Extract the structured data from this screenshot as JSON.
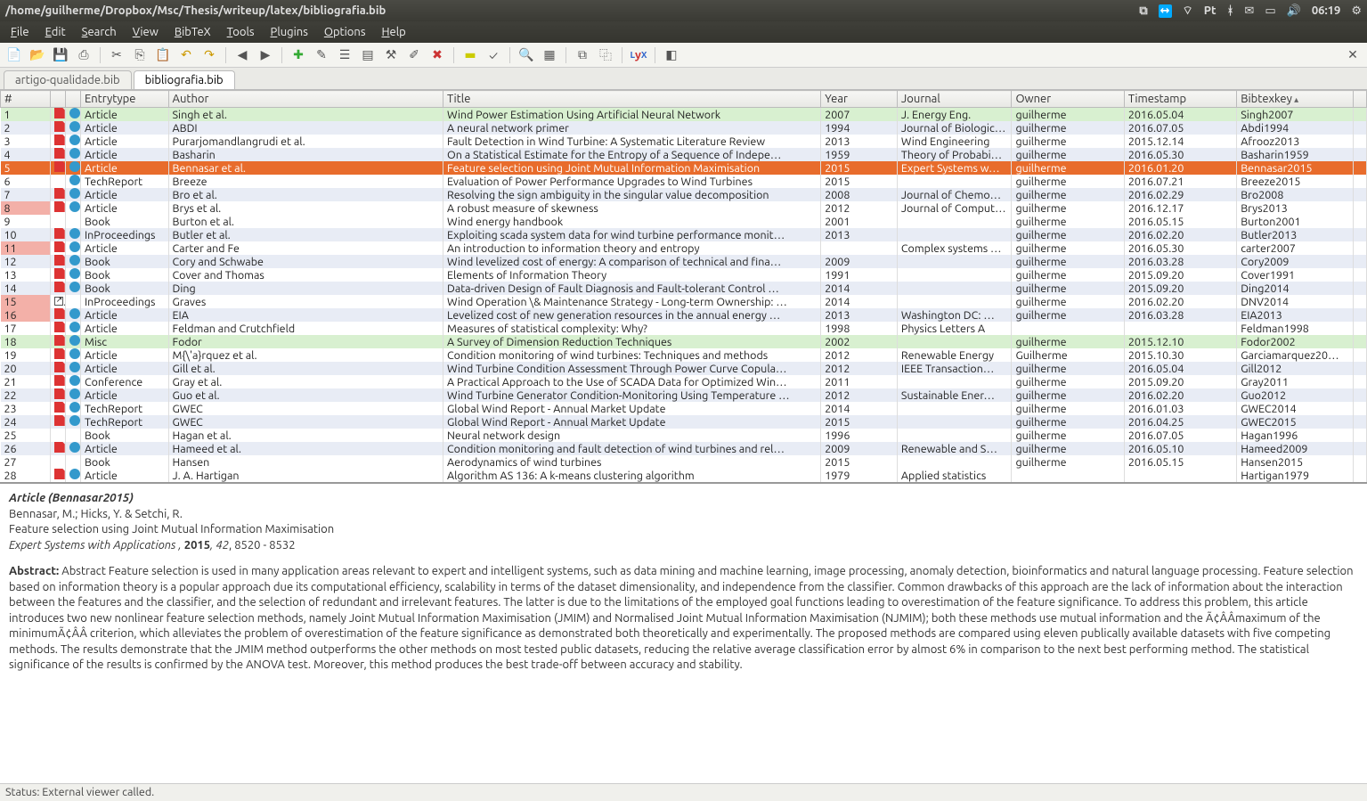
{
  "window": {
    "title": "/home/guilherme/Dropbox/Msc/Thesis/writeup/latex/bibliografia.bib"
  },
  "sys": {
    "clock": "06:19",
    "kb": "Pt"
  },
  "menu": {
    "file": "File",
    "edit": "Edit",
    "search": "Search",
    "view": "View",
    "bibtex": "BibTeX",
    "tools": "Tools",
    "plugins": "Plugins",
    "options": "Options",
    "help": "Help"
  },
  "tabs": [
    {
      "label": "artigo-qualidade.bib",
      "active": false
    },
    {
      "label": "bibliografia.bib",
      "active": true
    }
  ],
  "columns": {
    "num": "#",
    "type": "Entrytype",
    "auth": "Author",
    "title": "Title",
    "year": "Year",
    "jrnl": "Journal",
    "own": "Owner",
    "ts": "Timestamp",
    "key": "Bibtexkey"
  },
  "rows": [
    {
      "n": "1",
      "pdf": true,
      "lnk": true,
      "type": "Article",
      "auth": "Singh et al.",
      "title": "Wind Power Estimation Using Artificial Neural Network",
      "year": "2007",
      "jrnl": "J. Energy Eng.",
      "own": "guilherme",
      "ts": "2016.05.04",
      "key": "Singh2007",
      "cls": "green"
    },
    {
      "n": "2",
      "pdf": true,
      "lnk": true,
      "type": "Article",
      "auth": "ABDI",
      "title": "A neural network primer",
      "year": "1994",
      "jrnl": "Journal of Biologic…",
      "own": "guilherme",
      "ts": "2016.07.05",
      "key": "Abdi1994",
      "cls": "even"
    },
    {
      "n": "3",
      "pdf": true,
      "lnk": true,
      "type": "Article",
      "auth": "Purarjomandlangrudi et al.",
      "title": "Fault Detection in Wind Turbine: A Systematic Literature Review",
      "year": "2013",
      "jrnl": "Wind Engineering",
      "own": "guilherme",
      "ts": "2015.12.14",
      "key": "Afrooz2013",
      "cls": "odd"
    },
    {
      "n": "4",
      "pdf": true,
      "lnk": true,
      "type": "Article",
      "auth": "Basharin",
      "title": "On a Statistical Estimate for the Entropy of a Sequence of Indepe…",
      "year": "1959",
      "jrnl": "Theory of Probabi…",
      "own": "guilherme",
      "ts": "2016.05.30",
      "key": "Basharin1959",
      "cls": "even"
    },
    {
      "n": "5",
      "pdf": true,
      "lnk": true,
      "type": "Article",
      "auth": "Bennasar et al.",
      "title": "Feature selection using Joint Mutual Information Maximisation",
      "year": "2015",
      "jrnl": "Expert Systems w…",
      "own": "guilherme",
      "ts": "2016.01.20",
      "key": "Bennasar2015",
      "cls": "sel"
    },
    {
      "n": "6",
      "pdf": false,
      "lnk": true,
      "type": "TechReport",
      "auth": "Breeze",
      "title": "Evaluation of Power Performance Upgrades to Wind Turbines",
      "year": "2015",
      "jrnl": "",
      "own": "guilherme",
      "ts": "2016.07.21",
      "key": "Breeze2015",
      "cls": "odd"
    },
    {
      "n": "7",
      "pdf": true,
      "lnk": true,
      "type": "Article",
      "auth": "Bro et al.",
      "title": "Resolving the sign ambiguity in the singular value decomposition",
      "year": "2008",
      "jrnl": "Journal of Chemo…",
      "own": "guilherme",
      "ts": "2016.02.29",
      "key": "Bro2008",
      "cls": "even"
    },
    {
      "n": "8",
      "pdf": true,
      "lnk": true,
      "type": "Article",
      "auth": "Brys et al.",
      "title": "A robust measure of skewness",
      "year": "2012",
      "jrnl": "Journal of Comput…",
      "own": "guilherme",
      "ts": "2016.12.17",
      "key": "Brys2013",
      "cls": "odd red"
    },
    {
      "n": "9",
      "pdf": false,
      "lnk": false,
      "type": "Book",
      "auth": "Burton et al.",
      "title": "Wind energy handbook",
      "year": "2001",
      "jrnl": "",
      "own": "guilherme",
      "ts": "2016.05.15",
      "key": "Burton2001",
      "cls": "odd"
    },
    {
      "n": "10",
      "pdf": true,
      "lnk": true,
      "type": "InProceedings",
      "auth": "Butler et al.",
      "title": "Exploiting scada system data for wind turbine performance monit…",
      "year": "2013",
      "jrnl": "",
      "own": "guilherme",
      "ts": "2016.02.20",
      "key": "Butler2013",
      "cls": "even"
    },
    {
      "n": "11",
      "pdf": true,
      "lnk": true,
      "type": "Article",
      "auth": "Carter and Fe",
      "title": "An introduction to information theory and entropy",
      "year": "",
      "jrnl": "Complex systems …",
      "own": "guilherme",
      "ts": "2016.05.30",
      "key": "carter2007",
      "cls": "odd red"
    },
    {
      "n": "12",
      "pdf": true,
      "lnk": true,
      "type": "Book",
      "auth": "Cory and Schwabe",
      "title": "Wind levelized cost of energy: A comparison of technical and fina…",
      "year": "2009",
      "jrnl": "",
      "own": "guilherme",
      "ts": "2016.03.28",
      "key": "Cory2009",
      "cls": "even"
    },
    {
      "n": "13",
      "pdf": true,
      "lnk": true,
      "type": "Book",
      "auth": "Cover and Thomas",
      "title": "Elements of Information Theory",
      "year": "1991",
      "jrnl": "",
      "own": "guilherme",
      "ts": "2015.09.20",
      "key": "Cover1991",
      "cls": "odd"
    },
    {
      "n": "14",
      "pdf": true,
      "lnk": true,
      "type": "Book",
      "auth": "Ding",
      "title": "Data-driven Design of Fault Diagnosis and Fault-tolerant Control …",
      "year": "2014",
      "jrnl": "",
      "own": "guilherme",
      "ts": "2015.09.20",
      "key": "Ding2014",
      "cls": "even"
    },
    {
      "n": "15",
      "pdf": false,
      "lnk": false,
      "ext": true,
      "type": "InProceedings",
      "auth": "Graves",
      "title": "Wind Operation \\& Maintenance Strategy - Long-term Ownership: …",
      "year": "2014",
      "jrnl": "",
      "own": "guilherme",
      "ts": "2016.02.20",
      "key": "DNV2014",
      "cls": "odd red"
    },
    {
      "n": "16",
      "pdf": true,
      "lnk": true,
      "type": "Article",
      "auth": "EIA",
      "title": "Levelized cost of new generation resources in the annual energy …",
      "year": "2013",
      "jrnl": "Washington DC: …",
      "own": "guilherme",
      "ts": "2016.03.28",
      "key": "EIA2013",
      "cls": "even red"
    },
    {
      "n": "17",
      "pdf": true,
      "lnk": true,
      "type": "Article",
      "auth": "Feldman and Crutchfield",
      "title": "Measures of statistical complexity: Why?",
      "year": "1998",
      "jrnl": "Physics Letters A",
      "own": "",
      "ts": "",
      "key": "Feldman1998",
      "cls": "odd"
    },
    {
      "n": "18",
      "pdf": true,
      "lnk": true,
      "type": "Misc",
      "auth": "Fodor",
      "title": "A Survey of Dimension Reduction Techniques",
      "year": "2002",
      "jrnl": "",
      "own": "guilherme",
      "ts": "2015.12.10",
      "key": "Fodor2002",
      "cls": "green"
    },
    {
      "n": "19",
      "pdf": true,
      "lnk": true,
      "type": "Article",
      "auth": "M{\\'a}rquez et al.",
      "title": "Condition monitoring of wind turbines: Techniques and methods",
      "year": "2012",
      "jrnl": "Renewable Energy",
      "own": "Guilherme",
      "ts": "2015.10.30",
      "key": "Garciamarquez20…",
      "cls": "odd"
    },
    {
      "n": "20",
      "pdf": true,
      "lnk": true,
      "type": "Article",
      "auth": "Gill et al.",
      "title": "Wind Turbine Condition Assessment Through Power Curve Copula…",
      "year": "2012",
      "jrnl": "IEEE Transaction…",
      "own": "guilherme",
      "ts": "2016.05.04",
      "key": "Gill2012",
      "cls": "even"
    },
    {
      "n": "21",
      "pdf": true,
      "lnk": true,
      "type": "Conference",
      "auth": "Gray et al.",
      "title": "A Practical Approach to the Use of SCADA Data for Optimized Win…",
      "year": "2011",
      "jrnl": "",
      "own": "guilherme",
      "ts": "2015.09.20",
      "key": "Gray2011",
      "cls": "odd"
    },
    {
      "n": "22",
      "pdf": true,
      "lnk": true,
      "type": "Article",
      "auth": "Guo et al.",
      "title": "Wind Turbine Generator Condition-Monitoring Using Temperature …",
      "year": "2012",
      "jrnl": "Sustainable Ener…",
      "own": "guilherme",
      "ts": "2016.02.20",
      "key": "Guo2012",
      "cls": "even"
    },
    {
      "n": "23",
      "pdf": true,
      "lnk": true,
      "type": "TechReport",
      "auth": "GWEC",
      "title": "Global Wind Report - Annual Market Update",
      "year": "2014",
      "jrnl": "",
      "own": "guilherme",
      "ts": "2016.01.03",
      "key": "GWEC2014",
      "cls": "odd"
    },
    {
      "n": "24",
      "pdf": true,
      "lnk": true,
      "type": "TechReport",
      "auth": "GWEC",
      "title": "Global Wind Report - Annual Market Update",
      "year": "2015",
      "jrnl": "",
      "own": "guilherme",
      "ts": "2016.04.25",
      "key": "GWEC2015",
      "cls": "even"
    },
    {
      "n": "25",
      "pdf": false,
      "lnk": false,
      "type": "Book",
      "auth": "Hagan et al.",
      "title": "Neural network design",
      "year": "1996",
      "jrnl": "",
      "own": "guilherme",
      "ts": "2016.07.05",
      "key": "Hagan1996",
      "cls": "odd"
    },
    {
      "n": "26",
      "pdf": true,
      "lnk": true,
      "type": "Article",
      "auth": "Hameed et al.",
      "title": "Condition monitoring and fault detection of wind turbines and rel…",
      "year": "2009",
      "jrnl": "Renewable and S…",
      "own": "guilherme",
      "ts": "2016.05.10",
      "key": "Hameed2009",
      "cls": "even"
    },
    {
      "n": "27",
      "pdf": false,
      "lnk": false,
      "type": "Book",
      "auth": "Hansen",
      "title": "Aerodynamics of wind turbines",
      "year": "2015",
      "jrnl": "",
      "own": "guilherme",
      "ts": "2016.05.15",
      "key": "Hansen2015",
      "cls": "odd"
    },
    {
      "n": "28",
      "pdf": true,
      "lnk": true,
      "type": "Article",
      "auth": "J. A. Hartigan",
      "title": "Algorithm AS 136: A k-means clustering algorithm",
      "year": "1979",
      "jrnl": "Applied statistics",
      "own": "",
      "ts": "",
      "key": "Hartigan1979",
      "cls": "odd"
    }
  ],
  "detail": {
    "header": "Article (Bennasar2015)",
    "authors": "Bennasar, M.; Hicks, Y. & Setchi, R.",
    "title": "Feature selection using Joint Mutual Information Maximisation",
    "journal": "Expert Systems with Applications ,",
    "year": "2015",
    "vol": ", 42",
    "pages": ", 8520 - 8532",
    "abs_label": "Abstract:",
    "abstract": "Abstract Feature selection is used in many application areas relevant to expert and intelligent systems, such as data mining and machine learning, image processing, anomaly detection, bioinformatics and natural language processing. Feature selection based on information theory is a popular approach due its computational efficiency, scalability in terms of the dataset dimensionality, and independence from the classifier. Common drawbacks of this approach are the lack of information about the interaction between the features and the classifier, and the selection of redundant and irrelevant features. The latter is due to the limitations of the employed goal functions leading to overestimation of the feature significance. To address this problem, this article introduces two new nonlinear feature selection methods, namely Joint Mutual Information Maximisation (JMIM) and Normalised Joint Mutual Information Maximisation (NJMIM); both these methods use mutual information and the Ã¢ÂÂmaximum of the minimumÃ¢ÂÂ criterion, which alleviates the problem of overestimation of the feature significance as demonstrated both theoretically and experimentally. The proposed methods are compared using eleven publically available datasets with five competing methods. The results demonstrate that the JMIM method outperforms the other methods on most tested public datasets, reducing the relative average classification error by almost 6% in comparison to the next best performing method. The statistical significance of the results is confirmed by the ANOVA test. Moreover, this method produces the best trade-off between accuracy and stability."
  },
  "status": "Status: External viewer called."
}
